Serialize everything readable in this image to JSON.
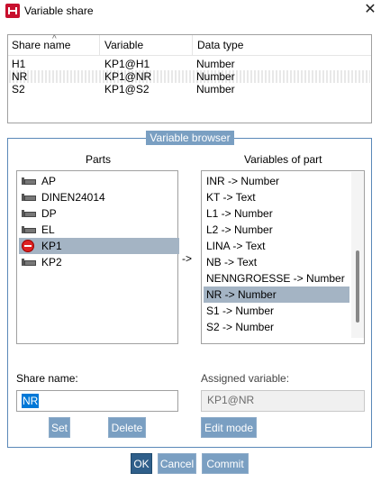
{
  "window": {
    "title": "Variable share",
    "close_glyph": "✕",
    "app_icon": "red-app-icon"
  },
  "share_table": {
    "columns": [
      "Share name",
      "Variable",
      "Data type"
    ],
    "rows": [
      {
        "share_name": "H1",
        "variable": "KP1@H1",
        "data_type": "Number"
      },
      {
        "share_name": "NR",
        "variable": "KP1@NR",
        "data_type": "Number"
      },
      {
        "share_name": "S2",
        "variable": "KP1@S2",
        "data_type": "Number"
      }
    ],
    "selected_row": 1,
    "sort_glyph": "^"
  },
  "browser": {
    "title": "Variable browser",
    "parts_label": "Parts",
    "variables_label": "Variables of part",
    "arrow": "->",
    "parts": [
      {
        "name": "AP",
        "icon": "part-icon"
      },
      {
        "name": "DINEN24014",
        "icon": "part-icon"
      },
      {
        "name": "DP",
        "icon": "part-icon"
      },
      {
        "name": "EL",
        "icon": "part-icon"
      },
      {
        "name": "KP1",
        "icon": "red-part-icon"
      },
      {
        "name": "KP2",
        "icon": "part-icon"
      }
    ],
    "selected_part": "KP1",
    "variables": [
      "INR -> Number",
      "KT -> Text",
      "L1 -> Number",
      "L2 -> Number",
      "LINA -> Text",
      "NB -> Text",
      "NENNGROESSE -> Number",
      "NR -> Number",
      "S1 -> Number",
      "S2 -> Number"
    ],
    "selected_variable": "NR -> Number"
  },
  "form": {
    "share_name_label": "Share name:",
    "share_name_value": "NR",
    "assigned_variable_label": "Assigned variable:",
    "assigned_variable_value": "KP1@NR",
    "set_label": "Set",
    "delete_label": "Delete",
    "edit_mode_label": "Edit mode"
  },
  "footer": {
    "ok_label": "OK",
    "cancel_label": "Cancel",
    "commit_label": "Commit"
  },
  "colors": {
    "accent": "#7a9fc2",
    "primary_button": "#2f5f8a",
    "selection": "#a4b4c4",
    "group_border": "#5a88b8",
    "text_selection": "#0078d7"
  }
}
